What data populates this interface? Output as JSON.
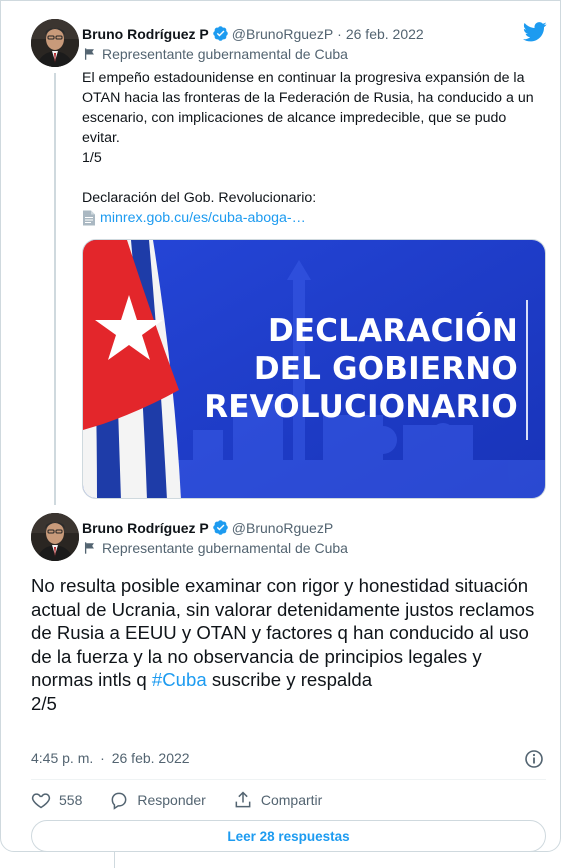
{
  "tweet1": {
    "author_name": "Bruno Rodríguez P",
    "handle": "@BrunoRguezP",
    "separator": "·",
    "date": "26 feb. 2022",
    "affiliation": "Representante gubernamental de Cuba",
    "body_line": "El empeño estadounidense en continuar la progresiva expansión de la OTAN hacia las fronteras de la Federación de Rusia, ha conducido a un escenario, con implicaciones de alcance impredecible, que se pudo evitar.",
    "counter": "1/5",
    "declaration_label": "Declaración del Gob. Revolucionario:",
    "link_text": "minrex.gob.cu/es/cuba-aboga-…",
    "card": {
      "lines": [
        "DECLARACIÓN",
        "DEL GOBIERNO",
        "REVOLUCIONARIO"
      ]
    }
  },
  "tweet2": {
    "author_name": "Bruno Rodríguez P",
    "handle": "@BrunoRguezP",
    "affiliation": "Representante gubernamental de Cuba",
    "body_before_hashtag": "No resulta posible examinar con rigor y honestidad situación actual de Ucrania, sin valorar detenidamente justos reclamos de Rusia a EEUU y OTAN y factores q han conducido al uso de la fuerza y la no observancia de principios legales y normas intls q ",
    "hashtag": "#Cuba",
    "body_after_hashtag": " suscribe y respalda",
    "counter": "2/5",
    "time": "4:45 p. m.",
    "meta_separator": "·",
    "date": "26 feb. 2022"
  },
  "actions": {
    "likes": "558",
    "reply_label": "Responder",
    "share_label": "Compartir"
  },
  "read_more_label": "Leer 28 respuestas",
  "colors": {
    "accent": "#1d9bf0",
    "text": "#0f1419",
    "muted": "#536471",
    "border": "#cfd9de",
    "card_blue": "#1d3ecf",
    "flag_red": "#e3262b"
  },
  "icons": {
    "bird": "twitter-bird-icon",
    "verified": "verified-badge-icon",
    "flag": "flag-icon",
    "doc": "document-icon",
    "info": "info-icon",
    "like": "heart-icon",
    "reply": "comment-icon",
    "share": "share-icon"
  }
}
